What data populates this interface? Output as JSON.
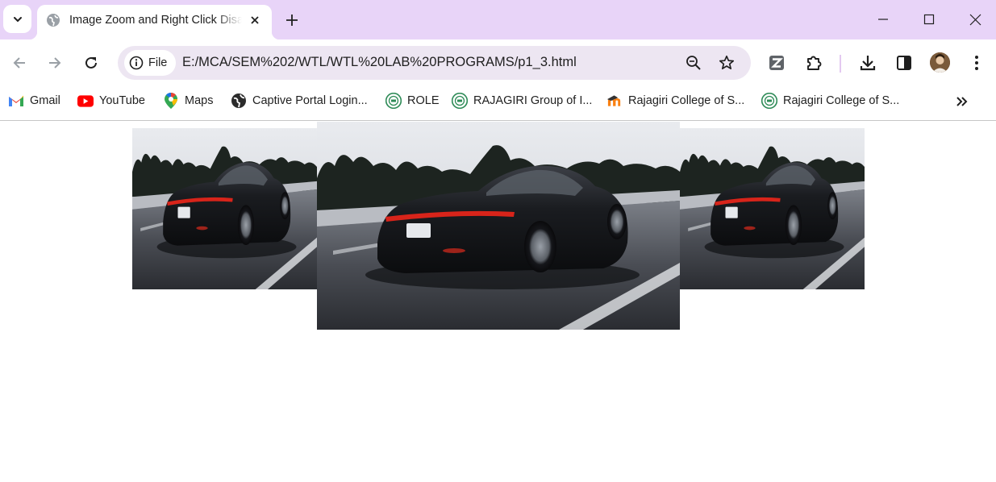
{
  "window": {
    "tab_title": "Image Zoom and Right Click Disabled",
    "tab_favicon": "globe-icon",
    "new_tab_icon": "plus-icon",
    "controls": [
      "minimize-icon",
      "maximize-icon",
      "close-icon"
    ]
  },
  "toolbar": {
    "site_chip_label": "File",
    "url": "E:/MCA/SEM%202/WTL/WTL%20LAB%20PROGRAMS/p1_3.html",
    "icons": [
      "back-arrow-icon",
      "forward-arrow-icon",
      "reload-icon",
      "info-icon",
      "zoom-icon",
      "star-icon",
      "extension-z-icon",
      "puzzle-icon",
      "download-icon",
      "side-panel-icon",
      "avatar",
      "kebab-menu-icon"
    ]
  },
  "bookmarks": [
    {
      "label": "Gmail",
      "icon": "gmail-icon"
    },
    {
      "label": "YouTube",
      "icon": "youtube-icon"
    },
    {
      "label": "Maps",
      "icon": "maps-icon"
    },
    {
      "label": "Captive Portal Login...",
      "icon": "globe-icon"
    },
    {
      "label": "ROLE",
      "icon": "rajagiri-seal-icon"
    },
    {
      "label": "RAJAGIRI Group of I...",
      "icon": "rajagiri-seal-icon"
    },
    {
      "label": "Rajagiri College of S...",
      "icon": "moodle-icon"
    },
    {
      "label": "Rajagiri College of S...",
      "icon": "rajagiri-seal-icon"
    }
  ],
  "page": {
    "images": [
      {
        "name": "car-image-left",
        "state": "normal"
      },
      {
        "name": "car-image-middle",
        "state": "zoomed"
      },
      {
        "name": "car-image-right",
        "state": "normal"
      }
    ]
  },
  "colors": {
    "tabstrip": "#e8d4f8",
    "omnibox": "#ede6f2",
    "youtube_red": "#ff0000",
    "rajagiri_green": "#2e8b57"
  }
}
